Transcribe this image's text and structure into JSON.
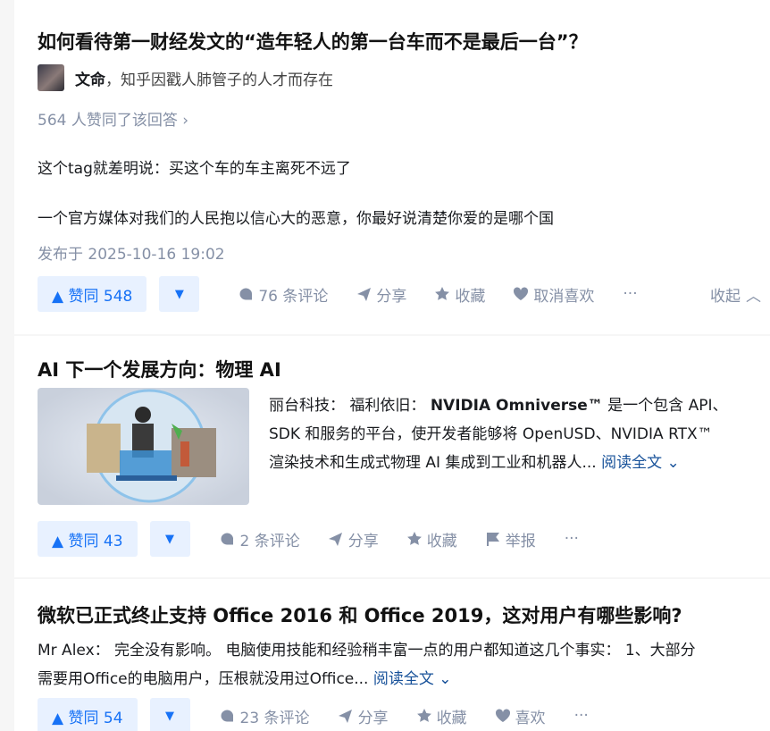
{
  "feed": [
    {
      "title": "如何看待第一财经发文的“造年轻人的第一台车而不是最后一台”？",
      "author_name": "文命",
      "author_bio": "，知乎因戳人肺管子的人才而存在",
      "voters_text": "564 人赞同了该回答",
      "paragraphs": [
        "这个tag就差明说：买这个车的车主离死不远了",
        "一个官方媒体对我们的人民抱以信心大的恶意，你最好说清楚你爱的是哪个国"
      ],
      "time": "发布于 2025-10-16 19:02",
      "vote_label": "▲ 赞同 548",
      "comments": "76 条评论",
      "share": "分享",
      "favorite": "收藏",
      "like": "取消喜欢",
      "more": "···",
      "collapse": "收起"
    },
    {
      "title": "AI 下一个发展方向：物理 AI",
      "excerpt_prefix": "丽台科技：  福利依旧：  ",
      "excerpt_bold": "NVIDIA Omniverse™",
      "excerpt_line1_rest": " 是一个包含 API、",
      "excerpt_line2": "SDK 和服务的平台，使开发者能够将 OpenUSD、NVIDIA RTX™",
      "excerpt_line3": "渲染技术和生成式物理 AI 集成到工业和机器人...",
      "read_more": "阅读全文",
      "vote_label": "▲ 赞同 43",
      "comments": "2 条评论",
      "share": "分享",
      "favorite": "收藏",
      "report": "举报",
      "more": "···"
    },
    {
      "title": "微软已正式终止支持 Office 2016 和 Office 2019，这对用户有哪些影响?",
      "excerpt_line1": "Mr Alex：  完全没有影响。 电脑使用技能和经验稍丰富一点的用户都知道这几个事实：  1、大部分",
      "excerpt_line2": "需要用Office的电脑用户，压根就没用过Office...",
      "read_more": "阅读全文",
      "vote_label": "▲ 赞同 54",
      "comments": "23 条评论",
      "share": "分享",
      "favorite": "收藏",
      "like": "喜欢",
      "more": "···"
    }
  ],
  "colors": {
    "accent": "#1772f6",
    "meta": "#8590a6",
    "vote_bg": "#e8f1ff",
    "link": "#175199"
  }
}
